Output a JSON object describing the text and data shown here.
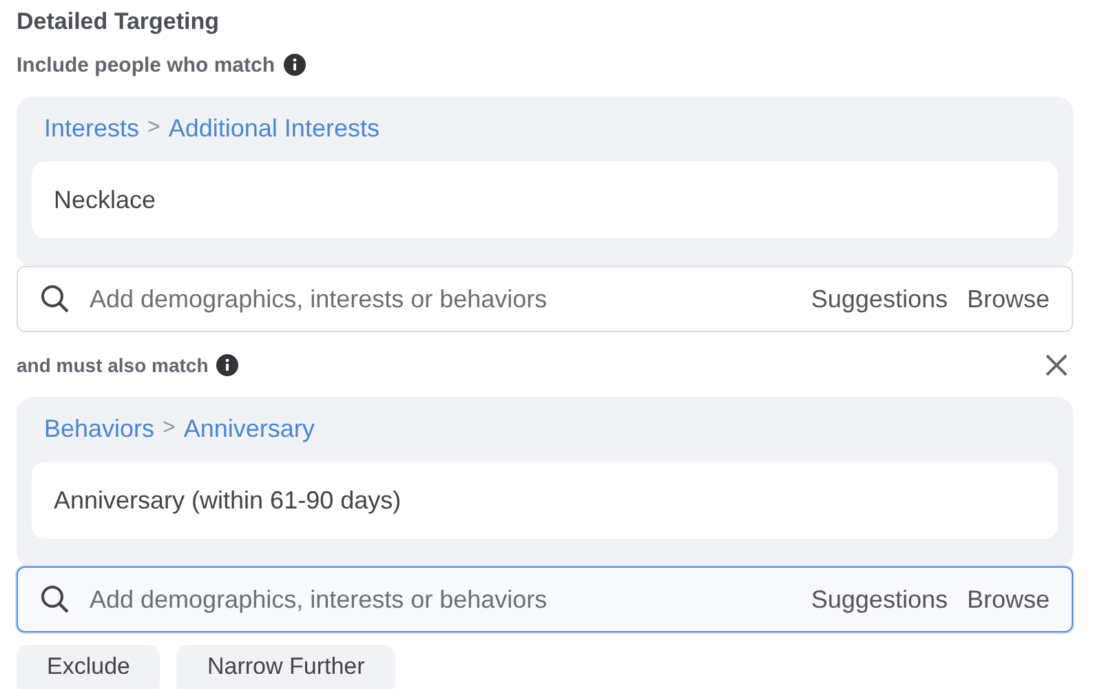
{
  "heading": "Detailed Targeting",
  "groups": [
    {
      "label": "Include people who match",
      "removable": false,
      "path": [
        "Interests",
        "Additional Interests"
      ],
      "separator": ">",
      "item": "Necklace",
      "search": {
        "placeholder": "Add demographics, interests or behaviors",
        "focused": false,
        "links": [
          "Suggestions",
          "Browse"
        ]
      }
    },
    {
      "label": "and must also match",
      "removable": true,
      "path": [
        "Behaviors",
        "Anniversary"
      ],
      "separator": ">",
      "item": "Anniversary (within 61-90 days)",
      "search": {
        "placeholder": "Add demographics, interests or behaviors",
        "focused": true,
        "links": [
          "Suggestions",
          "Browse"
        ]
      }
    }
  ],
  "buttons": [
    "Exclude",
    "Narrow Further"
  ]
}
